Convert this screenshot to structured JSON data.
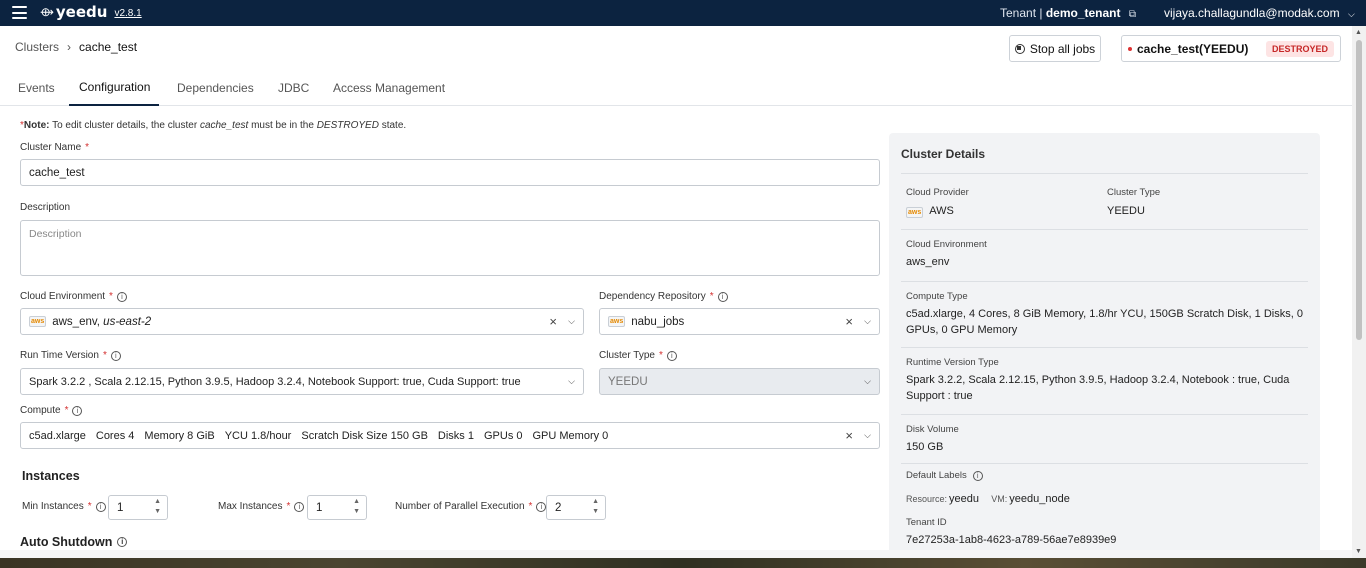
{
  "header": {
    "logo_text": "yeedu",
    "version": "v2.8.1",
    "tenant_label": "Tenant |",
    "tenant_name": "demo_tenant",
    "user_email": "vijaya.challagundla@modak.com"
  },
  "breadcrumb": {
    "root": "Clusters",
    "current": "cache_test"
  },
  "actions": {
    "stop_label": "Stop all jobs",
    "cluster_status_name": "cache_test(YEEDU)",
    "cluster_status": "DESTROYED"
  },
  "tabs": [
    {
      "label": "Events"
    },
    {
      "label": "Configuration"
    },
    {
      "label": "Dependencies"
    },
    {
      "label": "JDBC"
    },
    {
      "label": "Access Management"
    }
  ],
  "note": {
    "prefix": "Note:",
    "text1": "To edit cluster details, the cluster",
    "cluster": "cache_test",
    "text2": "must be in the",
    "state": "DESTROYED",
    "text3": "state."
  },
  "form": {
    "cluster_name_label": "Cluster Name",
    "cluster_name_value": "cache_test",
    "description_label": "Description",
    "description_placeholder": "Description",
    "cloud_env_label": "Cloud Environment",
    "cloud_env_value": "aws_env,",
    "cloud_env_region": "us-east-2",
    "dep_repo_label": "Dependency Repository",
    "dep_repo_value": "nabu_jobs",
    "runtime_label": "Run Time Version",
    "runtime_value": "Spark 3.2.2 , Scala 2.12.15, Python 3.9.5, Hadoop 3.2.4, Notebook Support: true, Cuda Support: true",
    "cluster_type_label": "Cluster Type",
    "cluster_type_value": "YEEDU",
    "compute_label": "Compute",
    "compute_items": [
      "c5ad.xlarge",
      "Cores  4",
      "Memory  8 GiB",
      "YCU  1.8/hour",
      "Scratch Disk Size  150 GB",
      "Disks  1",
      "GPUs  0",
      "GPU Memory  0"
    ],
    "instances_heading": "Instances",
    "min_label": "Min Instances",
    "min_value": "1",
    "max_label": "Max Instances",
    "max_value": "1",
    "parallel_label": "Number of Parallel Execution",
    "parallel_value": "2",
    "auto_shutdown_heading": "Auto Shutdown"
  },
  "details": {
    "title": "Cluster Details",
    "cloud_provider_label": "Cloud Provider",
    "cloud_provider_value": "AWS",
    "cluster_type_label": "Cluster Type",
    "cluster_type_value": "YEEDU",
    "cloud_env_label": "Cloud Environment",
    "cloud_env_value": "aws_env",
    "compute_type_label": "Compute Type",
    "compute_type_value": "c5ad.xlarge, 4 Cores, 8 GiB Memory, 1.8/hr YCU, 150GB Scratch Disk, 1 Disks, 0 GPUs, 0 GPU Memory",
    "runtime_label": "Runtime Version Type",
    "runtime_value": "Spark 3.2.2, Scala 2.12.15, Python 3.9.5, Hadoop 3.2.4, Notebook : true, Cuda Support : true",
    "disk_label": "Disk Volume",
    "disk_value": "150 GB",
    "labels_label": "Default Labels",
    "label1_key": "Resource:",
    "label1_value": "yeedu",
    "label2_key": "VM:",
    "label2_value": "yeedu_node",
    "tenant_id_label": "Tenant ID",
    "tenant_id_value": "7e27253a-1ab8-4623-a789-56ae7e8939e9"
  }
}
